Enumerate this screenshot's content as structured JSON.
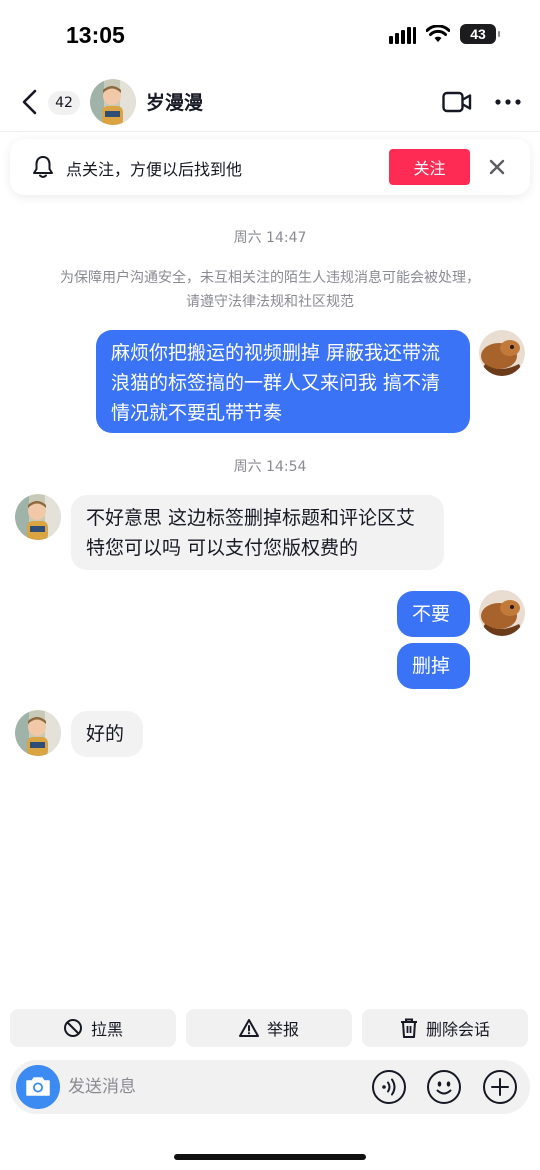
{
  "status_bar": {
    "time": "13:05",
    "battery": "43",
    "icons": [
      "signal-icon",
      "wifi-icon",
      "battery-icon"
    ]
  },
  "header": {
    "unread_count": "42",
    "name": "岁漫漫",
    "icons": [
      "back-arrow-icon",
      "video-call-icon",
      "more-icon"
    ]
  },
  "follow_banner": {
    "text": "点关注，方便以后找到他",
    "button_label": "关注",
    "icons": [
      "bell-icon",
      "close-icon"
    ]
  },
  "chat": {
    "timestamp_1": "周六 14:47",
    "notice": "为保障用户沟通安全，未互相关注的陌生人违规消息可能会被处理，请遵守法律法规和社区规范",
    "message_1": "麻烦你把搬运的视频删掉 屏蔽我还带流浪猫的标签搞的一群人又来问我 搞不清情况就不要乱带节奏",
    "timestamp_2": "周六 14:54",
    "message_2": "不好意思  这边标签删掉标题和评论区艾特您可以吗 可以支付您版权费的",
    "message_3": "不要",
    "message_4": "删掉",
    "message_5": "好的"
  },
  "actions": {
    "block": "拉黑",
    "report": "举报",
    "delete_chat": "删除会话"
  },
  "input": {
    "placeholder": "发送消息",
    "icons": [
      "camera-icon",
      "voice-icon",
      "emoji-icon",
      "plus-icon"
    ]
  },
  "colors": {
    "accent_red": "#fe2c55",
    "my_bubble": "#3a73f6",
    "their_bubble": "#f2f2f3",
    "camera_blue": "#3b8bf3"
  }
}
